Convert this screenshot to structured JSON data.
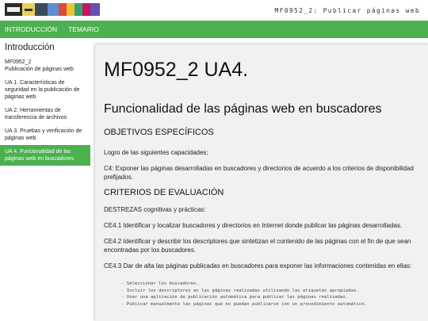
{
  "header": {
    "site_title": "MF0952_2: Publicar páginas web"
  },
  "nav": {
    "items": [
      "INTRODUCCIÓN",
      "TEMARIO"
    ]
  },
  "sidebar": {
    "title": "Introducción",
    "items": [
      {
        "label": "MF0952_2\nPublicación de páginas web",
        "active": false
      },
      {
        "label": "UA 1. Características de seguridad en la publicación de páginas web",
        "active": false
      },
      {
        "label": "UA 2. Herramientas de transferencia de archivos",
        "active": false
      },
      {
        "label": "UA 3. Pruebas y verificación de páginas web",
        "active": false
      },
      {
        "label": "UA 4. Funcionalidad de las páginas web en buscadores",
        "active": true
      }
    ]
  },
  "main": {
    "title": "MF0952_2 UA4.",
    "subtitle": "Funcionalidad de las páginas web en buscadores",
    "objetivos_heading": "OBJETIVOS ESPECÍFICOS",
    "logro": "Logro de las siguientes capacidades:",
    "c4": "C4: Exponer las páginas desarrolladas en buscadores y directorios de acuerdo a los criterios de disponibilidad prefijados.",
    "criterios_heading": "CRITERIOS DE EVALUACIÓN",
    "destrezas": "DESTREZAS cognitivas y prácticas:",
    "ce41": "CE4.1 Identificar y localizar buscadores y directorios en Internet donde publicar las páginas desarrolladas.",
    "ce42": "CE4.2 Identificar y describir los descriptores que sintetizan el contenido de las páginas con el fin de que sean encontradas por los buscadores.",
    "ce43": "CE4.3 Dar de alta las páginas publicadas en buscadores para exponer las informaciones contenidas en ellas:",
    "bullets": [
      "Seleccionar los buscadores.",
      "Incluir los descriptores en las páginas realizadas utilizando las etiquetas apropiadas.",
      "Usar una aplicación de publicación automática para publicar las páginas realizadas.",
      "Publicar manualmente las páginas que no puedan publicarse con un procedimiento automático."
    ]
  },
  "colors": {
    "accent": "#4caf50",
    "content_bg": "#f1f1f1"
  }
}
